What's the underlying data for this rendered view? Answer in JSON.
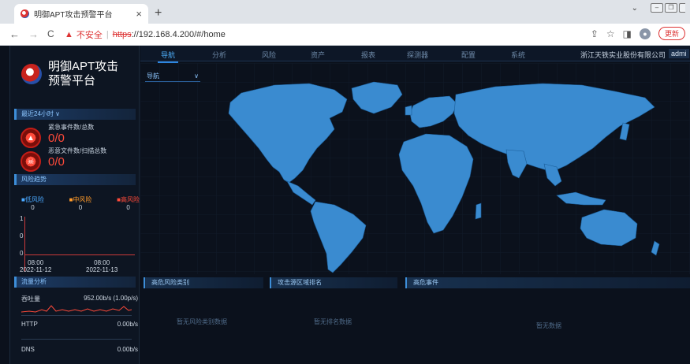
{
  "browser": {
    "tab_title": "明御APT攻击预警平台",
    "tab_close": "×",
    "new_tab": "+",
    "nav_back": "←",
    "nav_forward": "→",
    "nav_reload": "C",
    "insecure_label": "不安全",
    "url_scheme": "https",
    "url_rest": "://192.168.4.200/#/home",
    "update_label": "更新"
  },
  "app": {
    "brand_line1": "明御APT攻击",
    "brand_line2": "预警平台",
    "period_select": "最近24小时 ∨",
    "emergency_label": "紧急事件数/总数",
    "emergency_value": "0/0",
    "malicious_label": "恶意文件数/扫描总数",
    "malicious_value": "0/0",
    "risk_trend_title": "风险趋势",
    "risk_low_label": "■低风险",
    "risk_mid_label": "■中风险",
    "risk_high_label": "■高风险",
    "risk_low_value": "0",
    "risk_mid_value": "0",
    "risk_high_value": "0",
    "trend_y_labels": [
      "1",
      "0",
      "0"
    ],
    "trend_x1_time": "08:00",
    "trend_x1_date": "2022-11-12",
    "trend_x2_time": "08:00",
    "trend_x2_date": "2022-11-13",
    "traffic_title": "流量分析",
    "throughput_label": "吞吐量",
    "throughput_value": "952.00b/s (1.00p/s)",
    "http_label": "HTTP",
    "http_value": "0.00b/s",
    "dns_label": "DNS",
    "dns_value": "0.00b/s"
  },
  "nav": {
    "items": [
      "导航",
      "分析",
      "风险",
      "资产",
      "报表",
      "探测器",
      "配置",
      "系统"
    ],
    "company": "浙江天铁实业股份有限公司",
    "user": "admi"
  },
  "map_select": "导航",
  "panels": {
    "high_risk_types": "高危风险类别",
    "high_risk_types_empty": "暂无风险类别数据",
    "source_rank": "攻击源区域排名",
    "source_rank_empty": "暂无排名数据",
    "high_risk_events": "高危事件",
    "high_risk_events_empty": "暂无数据"
  },
  "colors": {
    "accent": "#2e86e0",
    "danger": "#ff4a3a",
    "map_land": "#3a8bd0"
  }
}
